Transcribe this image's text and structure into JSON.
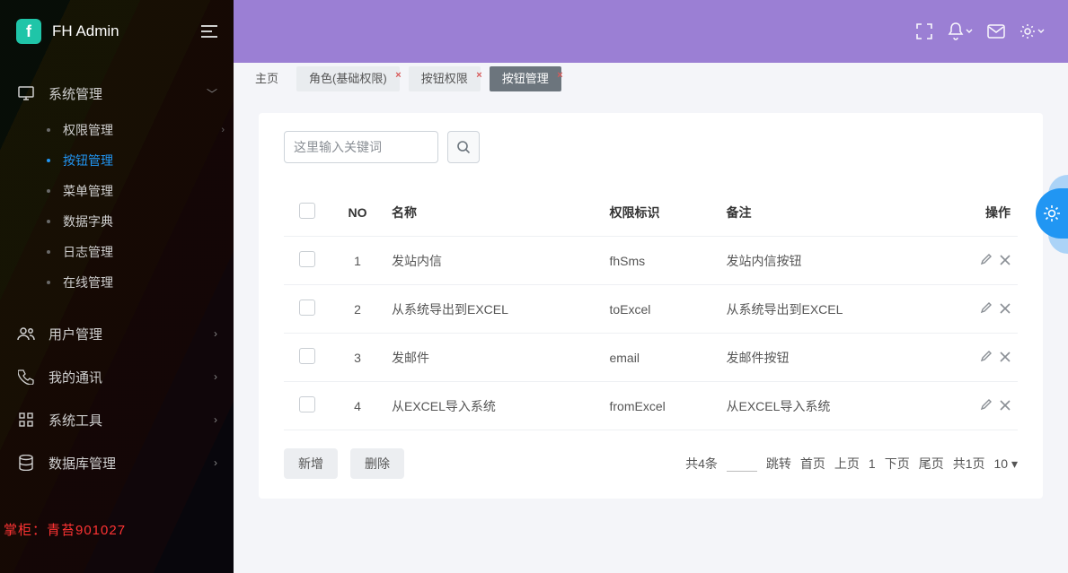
{
  "brand": {
    "logo": "f",
    "title": "FH Admin"
  },
  "sidebar": {
    "groups": [
      {
        "icon": "monitor",
        "label": "系统管理",
        "open": true,
        "children": [
          {
            "label": "权限管理",
            "active": false
          },
          {
            "label": "按钮管理",
            "active": true
          },
          {
            "label": "菜单管理",
            "active": false
          },
          {
            "label": "数据字典",
            "active": false
          },
          {
            "label": "日志管理",
            "active": false
          },
          {
            "label": "在线管理",
            "active": false
          }
        ]
      },
      {
        "icon": "users",
        "label": "用户管理"
      },
      {
        "icon": "phone",
        "label": "我的通讯"
      },
      {
        "icon": "grid",
        "label": "系统工具"
      },
      {
        "icon": "db",
        "label": "数据库管理"
      }
    ]
  },
  "watermark": "掌柜：青苔901027",
  "tabs": [
    {
      "label": "主页",
      "plain": true,
      "closable": false
    },
    {
      "label": "角色(基础权限)",
      "closable": true
    },
    {
      "label": "按钮权限",
      "closable": true
    },
    {
      "label": "按钮管理",
      "closable": true,
      "active": true
    }
  ],
  "search": {
    "placeholder": "这里输入关键词"
  },
  "table": {
    "cols": {
      "no": "NO",
      "name": "名称",
      "code": "权限标识",
      "remark": "备注",
      "ops": "操作"
    },
    "rows": [
      {
        "no": "1",
        "name": "发站内信",
        "code": "fhSms",
        "remark": "发站内信按钮"
      },
      {
        "no": "2",
        "name": "从系统导出到EXCEL",
        "code": "toExcel",
        "remark": "从系统导出到EXCEL"
      },
      {
        "no": "3",
        "name": "发邮件",
        "code": "email",
        "remark": "发邮件按钮"
      },
      {
        "no": "4",
        "name": "从EXCEL导入系统",
        "code": "fromExcel",
        "remark": "从EXCEL导入系统"
      }
    ],
    "footer": {
      "add": "新增",
      "del": "删除",
      "total": "共4条",
      "jump": "跳转",
      "first": "首页",
      "prev": "上页",
      "cur": "1",
      "next": "下页",
      "last": "尾页",
      "pages": "共1页",
      "pagesize": "10"
    }
  }
}
